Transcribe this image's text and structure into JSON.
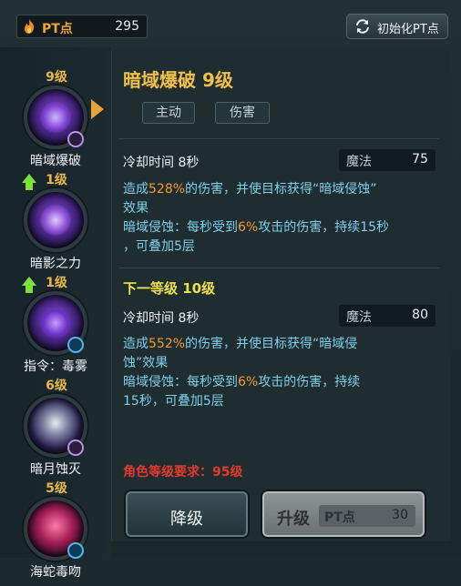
{
  "topbar": {
    "pt_label": "PT点",
    "pt_value": "295",
    "reset_label": "初始化PT点"
  },
  "skills": [
    {
      "level": "9级",
      "name": "暗域爆破",
      "badge": "purple",
      "upgrade": false,
      "selected": true
    },
    {
      "level": "1级",
      "name": "暗影之力",
      "badge": "none",
      "upgrade": true,
      "selected": false
    },
    {
      "level": "1级",
      "name": "指令：毒雾",
      "badge": "water",
      "upgrade": true,
      "selected": false
    },
    {
      "level": "6级",
      "name": "暗月蚀灭",
      "badge": "purple",
      "upgrade": false,
      "selected": false
    },
    {
      "level": "5级",
      "name": "海蛇毒吻",
      "badge": "water",
      "upgrade": false,
      "selected": false
    }
  ],
  "detail": {
    "title": "暗域爆破 9级",
    "tags": [
      "主动",
      "伤害"
    ],
    "current": {
      "cooldown": "冷却时间 8秒",
      "mana_label": "魔法",
      "mana_value": "75",
      "desc1_a": "造成",
      "desc1_pct": "528%",
      "desc1_b": "的伤害，并使目标获得“暗域侵蚀”",
      "desc1_c": "效果",
      "desc2_a": "暗域侵蚀：每秒受到",
      "desc2_pct": "6%",
      "desc2_b": "攻击的伤害，持续15秒",
      "desc2_c": "，可叠加5层"
    },
    "next_title": "下一等级 10级",
    "next": {
      "cooldown": "冷却时间 8秒",
      "mana_label": "魔法",
      "mana_value": "80",
      "desc1_a": "造成",
      "desc1_pct": "552%",
      "desc1_b": "的伤害，并使目标获得“暗域侵",
      "desc1_c": "蚀”效果",
      "desc2_a": "暗域侵蚀：每秒受到",
      "desc2_pct": "6%",
      "desc2_b": "攻击的伤害，持续",
      "desc2_c": "15秒，可叠加5层"
    },
    "requirement": "角色等级要求：95级"
  },
  "buttons": {
    "downgrade_label": "降级",
    "upgrade_label": "升级",
    "cost_label": "PT点",
    "cost_value": "30"
  },
  "colors": {
    "accent_gold": "#f0c04a",
    "highlight_orange": "#f49b2f",
    "desc_blue": "#7fd0ea",
    "requirement_red": "#e23a2c"
  }
}
